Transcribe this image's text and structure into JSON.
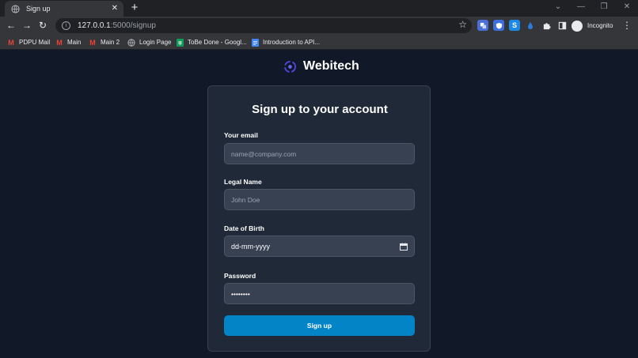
{
  "browser": {
    "tab": {
      "title": "Sign up",
      "close_glyph": "✕",
      "favicon": "globe-icon"
    },
    "new_tab_glyph": "+",
    "window_controls": {
      "dropdown": "⌄",
      "minimize": "—",
      "restore": "❐",
      "close": "✕"
    },
    "nav": {
      "back": "←",
      "forward": "→",
      "reload": "↻"
    },
    "address": {
      "host": "127.0.0.1",
      "path": ":5000/signup"
    },
    "bookmark_star": "☆",
    "extensions": [
      {
        "name": "translate-icon",
        "color": "#4a6fd8"
      },
      {
        "name": "shield-icon",
        "color": "#3d6fe0"
      },
      {
        "name": "s-extension-icon",
        "color": "#1e88e5"
      },
      {
        "name": "drop-icon",
        "color": "#2b7bdc"
      },
      {
        "name": "puzzle-icon",
        "color": "#35363a"
      },
      {
        "name": "side-panel-icon",
        "color": "#35363a"
      }
    ],
    "profile_label": "Incognito",
    "menu_glyph": "⋮",
    "bookmarks": [
      {
        "label": "PDPU Mail",
        "icon": "gmail-icon",
        "color": "#ea4335"
      },
      {
        "label": "Main",
        "icon": "gmail-icon",
        "color": "#ea4335"
      },
      {
        "label": "Main 2",
        "icon": "gmail-icon",
        "color": "#ea4335"
      },
      {
        "label": "Login Page",
        "icon": "globe-icon",
        "color": "#bdc1c6"
      },
      {
        "label": "ToBe Done - Googl...",
        "icon": "sheets-icon",
        "color": "#0f9d58"
      },
      {
        "label": "Introduction to API...",
        "icon": "doc-icon",
        "color": "#4285f4"
      }
    ]
  },
  "page": {
    "brand": "Webitech",
    "title": "Sign up to your account",
    "email": {
      "label": "Your email",
      "placeholder": "name@company.com"
    },
    "name": {
      "label": "Legal Name",
      "placeholder": "John Doe"
    },
    "dob": {
      "label": "Date of Birth",
      "value": "dd-mm-yyyy"
    },
    "password": {
      "label": "Password",
      "value": "••••••••"
    },
    "submit_label": "Sign up",
    "colors": {
      "background": "#111827",
      "card": "#1f2937",
      "input": "#374151",
      "accent": "#0284c7"
    }
  }
}
